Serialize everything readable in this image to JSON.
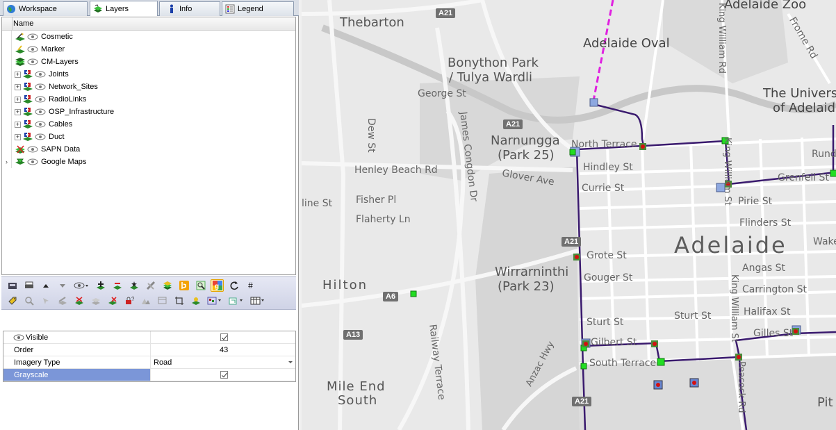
{
  "tabs": [
    {
      "label": "Workspace",
      "icon": "globe-icon",
      "active": false
    },
    {
      "label": "Layers",
      "icon": "layers-icon",
      "active": true
    },
    {
      "label": "Info",
      "icon": "info-icon",
      "active": false
    },
    {
      "label": "Legend",
      "icon": "legend-icon",
      "active": false
    }
  ],
  "tree": {
    "header": "Name",
    "items": [
      {
        "label": "Cosmetic",
        "indent": 0,
        "icon": "cosmetic-layer-icon",
        "expandable": false
      },
      {
        "label": "Marker",
        "indent": 0,
        "icon": "marker-layer-icon",
        "expandable": false
      },
      {
        "label": "CM-Layers",
        "indent": 0,
        "icon": "layer-group-icon",
        "expandable": false
      },
      {
        "label": "Joints",
        "indent": 1,
        "icon": "db-layer-icon",
        "expandable": true
      },
      {
        "label": "Network_Sites",
        "indent": 1,
        "icon": "db-layer-icon",
        "expandable": true
      },
      {
        "label": "RadioLinks",
        "indent": 1,
        "icon": "db-layer-icon",
        "expandable": true
      },
      {
        "label": "OSP_Infrastructure",
        "indent": 1,
        "icon": "db-layer-icon",
        "expandable": true
      },
      {
        "label": "Cables",
        "indent": 1,
        "icon": "db-layer-icon",
        "expandable": true
      },
      {
        "label": "Duct",
        "indent": 1,
        "icon": "db-layer-icon",
        "expandable": true
      },
      {
        "label": "SAPN Data",
        "indent": 0,
        "icon": "disabled-layer-icon",
        "expandable": false
      },
      {
        "label": "Google Maps",
        "indent": 0,
        "icon": "map-layer-icon",
        "expandable": false,
        "current": true
      }
    ]
  },
  "properties": {
    "visible_label": "Visible",
    "order_label": "Order",
    "order_value": "43",
    "imagery_label": "Imagery Type",
    "imagery_value": "Road",
    "grayscale_label": "Grayscale"
  },
  "map": {
    "labels": {
      "thebarton": "Thebarton",
      "bonython": "Bonython Park",
      "tulya": "/ Tulya Wardli",
      "adelaide_oval": "Adelaide Oval",
      "adelaide_zoo": "Adelaide Zoo",
      "george_st": "George St",
      "dew_st": "Dew St",
      "james_congdon": "James Congdon Dr",
      "narnungga": "Narnungga",
      "park25": "(Park 25)",
      "north_terrace": "North Terrace",
      "hindley": "Hindley St",
      "currie": "Currie St",
      "henley": "Henley Beach Rd",
      "glover": "Glover Ave",
      "fisher": "Fisher Pl",
      "flaherty": "Flaherty Ln",
      "line_st": "line St",
      "pirie": "Pirie St",
      "flinders": "Flinders St",
      "grenfell": "Grenfell St",
      "rund": "Rund",
      "univ1": "The Univers",
      "univ2": "of Adelaid",
      "king_william_top": "King William Rd",
      "king_william_mid": "King William St",
      "king_william_low": "King William St",
      "frome": "Frome Rd",
      "adelaide": "Adelaide",
      "wake": "Wake",
      "grote": "Grote St",
      "gouger": "Gouger St",
      "angas": "Angas St",
      "carrington": "Carrington St",
      "halifax": "Halifax St",
      "sturt1": "Sturt St",
      "sturt2": "Sturt St",
      "gilbert": "Gilbert St",
      "gilles": "Gilles St",
      "south_terrace": "South Terrace",
      "wirrarninthi": "Wirrarninthi",
      "park23": "(Park 23)",
      "hilton": "Hilton",
      "railway": "Railway Terrace",
      "mile_end1": "Mile End",
      "mile_end2": "South",
      "anzac": "Anzac Hwy",
      "peacock": "Peacock Rd",
      "pit": "Pit"
    },
    "shields": {
      "a21_top": "A21",
      "a21_mid": "A21",
      "a21_low": "A21",
      "a21_bottom": "A21",
      "a6": "A6",
      "a13": "A13"
    },
    "route_color": "#3a1a6e",
    "link_color": "#e020e0"
  }
}
